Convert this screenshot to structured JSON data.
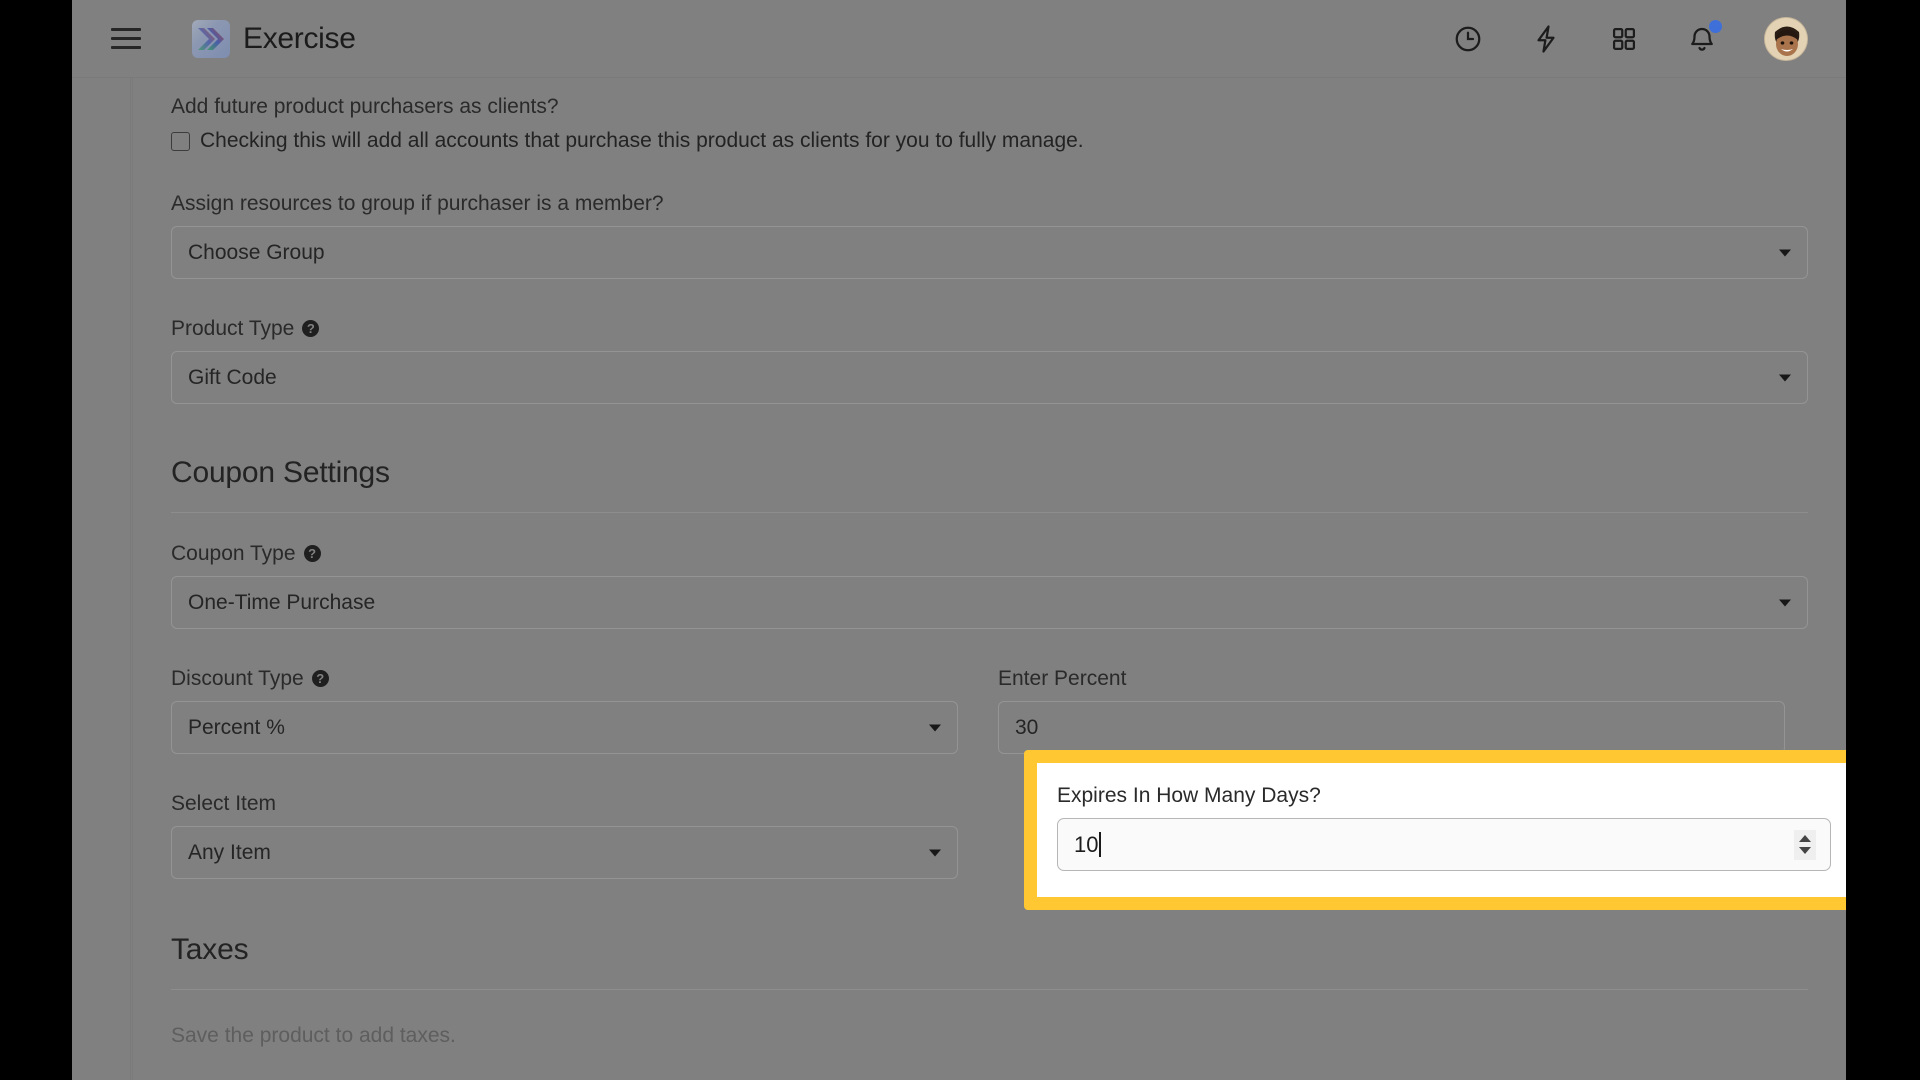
{
  "appbar": {
    "menu_icon": "hamburger-menu-icon",
    "brand_title": "Exercise",
    "logo_icon": "brand-logo-icon",
    "actions": [
      {
        "name": "history-clock-icon",
        "label": "Clock"
      },
      {
        "name": "lightning-bolt-icon",
        "label": "Quick Actions"
      },
      {
        "name": "apps-grid-icon",
        "label": "Apps"
      },
      {
        "name": "notifications-bell-icon",
        "label": "Notifications",
        "has_badge": true
      }
    ],
    "avatar_label": "User Avatar",
    "notification_dot_color": "#3f6fd8"
  },
  "form": {
    "clients_question": "Add future product purchasers as clients?",
    "clients_checkbox_text": "Checking this will add all accounts that purchase this product as clients for you to fully manage.",
    "clients_checkbox_checked": false,
    "group_label": "Assign resources to group if purchaser is a member?",
    "group_value": "Choose Group",
    "product_type_label": "Product Type",
    "product_type_value": "Gift Code",
    "help_glyph": "?"
  },
  "coupon": {
    "section_title": "Coupon Settings",
    "coupon_type_label": "Coupon Type",
    "coupon_type_value": "One-Time Purchase",
    "discount_type_label": "Discount Type",
    "discount_type_value": "Percent %",
    "enter_percent_label": "Enter Percent",
    "enter_percent_value": "30",
    "select_item_label": "Select Item",
    "select_item_value": "Any Item"
  },
  "highlight": {
    "expires_label": "Expires In How Many Days?",
    "expires_value": "10",
    "border_color": "#ffc832",
    "spinner_up_icon": "spinner-up-arrow-icon",
    "spinner_down_icon": "spinner-down-arrow-icon"
  },
  "taxes": {
    "section_title": "Taxes",
    "empty_text": "Save the product to add taxes."
  }
}
